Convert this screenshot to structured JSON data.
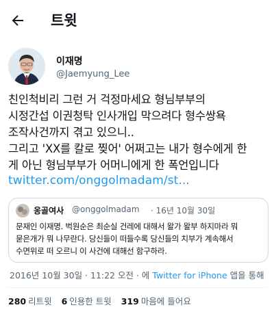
{
  "header": {
    "title": "트윗"
  },
  "author": {
    "name": "이재명",
    "handle": "@Jaemyung_Lee"
  },
  "tweet": {
    "lines": [
      "친인척비리 그런 거 걱정마세요 형님부부의",
      "시정간섭 이권청탁 인사개입 막으려다 형수쌍욕",
      "조작사건까지 겪고 있으니..",
      "그리고 'XX를 칼로 찢어' 어쩌고는 내가 형수에게 한",
      "게 아닌 형님부부가 어머니에게 한 폭언입니다"
    ],
    "link": "twitter.com/onggolmadam/st..."
  },
  "quote": {
    "name": "옹골여사",
    "handle": "@onggolmadam",
    "date": "· 16년 10월 30일",
    "lines": [
      "문재인  이재명. 벅원순은 최순실 건레에 대해서 왈가 왈부 하지마라 뭐",
      "묻은개가 뭐 나무란다. 당신들이 떠들수록 당신들의 치부가  계속해서",
      "수면위로 떠 오르니  이 사건에 대해선 함구하라."
    ]
  },
  "meta": {
    "timestamp": "2016년 10월 30일 · 11:22 오전 · 에",
    "client": "Twitter for iPhone",
    "suffix": "앱을 통해"
  },
  "stats": {
    "retweets_count": "280",
    "retweets_label": "리트윗",
    "quotes_count": "6",
    "quotes_label": "인용한 트윗",
    "likes_count": "319",
    "likes_label": "마음에 들어요"
  },
  "colors": {
    "link": "#1d9bf0",
    "secondary": "#536471",
    "text": "#0f1419"
  },
  "icons": {
    "back": "arrow-left-icon"
  }
}
